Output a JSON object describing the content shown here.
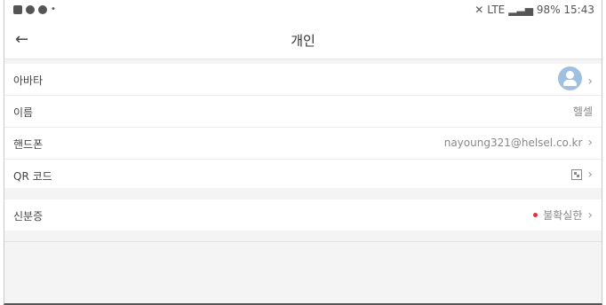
{
  "status": {
    "right_text": "98% 15:43",
    "signal": "LTE",
    "icons": [
      "image-icon",
      "notification-icon",
      "accessibility-icon"
    ]
  },
  "header": {
    "title": "개인",
    "back_icon": "back-arrow-icon"
  },
  "profile": {
    "rows": [
      {
        "label": "아바타",
        "value": "",
        "kind": "avatar"
      },
      {
        "label": "이름",
        "value": "헬셀",
        "kind": "text"
      },
      {
        "label": "핸드폰",
        "value": "nayoung321@helsel.co.kr",
        "kind": "text"
      },
      {
        "label": "QR 코드",
        "value": "",
        "kind": "qr"
      }
    ]
  },
  "identity": {
    "label": "신분증",
    "value": "불확실한",
    "status_color": "#dd3333"
  }
}
